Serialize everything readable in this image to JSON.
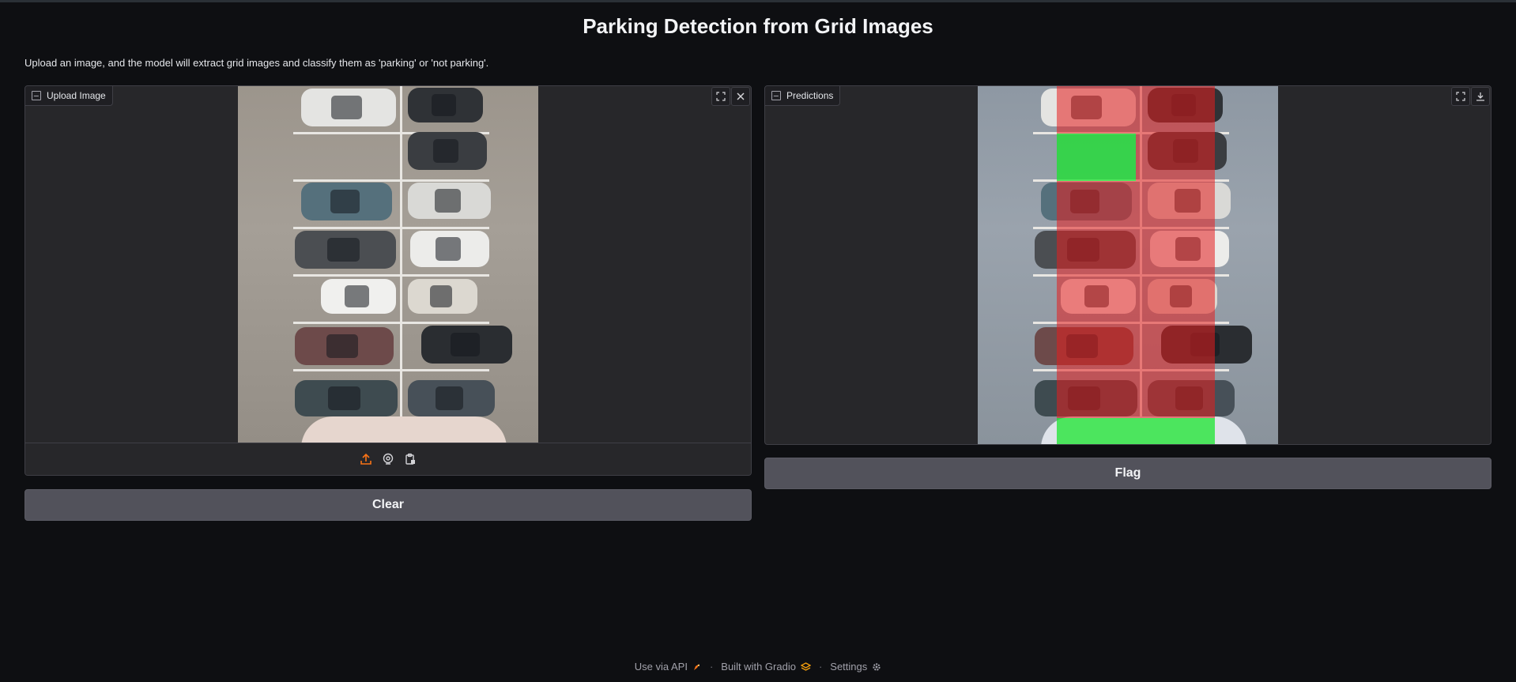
{
  "page": {
    "title": "Parking Detection from Grid Images",
    "description": "Upload an image, and the model will extract grid images and classify them as 'parking' or 'not parking'."
  },
  "input_panel": {
    "label": "Upload Image",
    "label_icon": "image-icon",
    "corner_icons": [
      "fullscreen-icon",
      "close-icon"
    ],
    "source_icons": [
      "upload-icon",
      "webcam-icon",
      "clipboard-icon"
    ]
  },
  "output_panel": {
    "label": "Predictions",
    "label_icon": "image-icon",
    "corner_icons": [
      "fullscreen-icon",
      "download-icon"
    ],
    "overlay_colors": {
      "not_parking": "#e61e1e",
      "parking": "#14e628"
    }
  },
  "buttons": {
    "clear_label": "Clear",
    "flag_label": "Flag"
  },
  "footer": {
    "api_label": "Use via API",
    "built_label": "Built with Gradio",
    "settings_label": "Settings",
    "separator": "·"
  },
  "colors": {
    "background": "#0e0f12",
    "panel": "#27272a",
    "button": "#52525b",
    "accent_orange": "#f97316"
  }
}
